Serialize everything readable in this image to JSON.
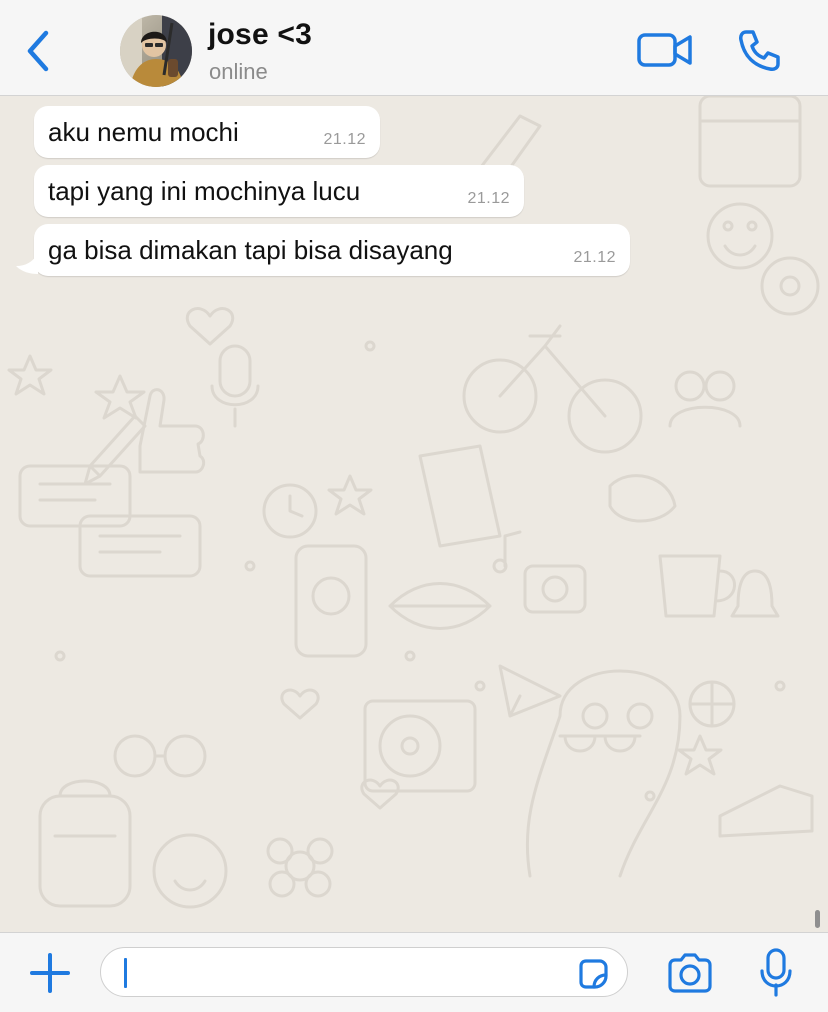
{
  "header": {
    "contact_name": "jose <3",
    "status": "online"
  },
  "messages": [
    {
      "text": "aku nemu mochi",
      "time": "21.12"
    },
    {
      "text": "tapi yang ini mochinya lucu",
      "time": "21.12"
    },
    {
      "text": "ga bisa dimakan tapi bisa disayang",
      "time": "21.12"
    }
  ],
  "composer": {
    "value": "",
    "placeholder": ""
  },
  "icons": {
    "back": "chevron-left-icon",
    "video": "video-camera-icon",
    "call": "phone-icon",
    "attach": "plus-icon",
    "sticker": "sticker-icon",
    "camera": "camera-icon",
    "mic": "microphone-icon"
  },
  "colors": {
    "accent": "#1f7ae0",
    "header_bg": "#f6f6f6",
    "chat_bg": "#ede9e2",
    "bubble_bg": "#ffffff",
    "name_text": "#111111",
    "status_text": "#8b8b8b",
    "timestamp_text": "#9a9a9a"
  }
}
